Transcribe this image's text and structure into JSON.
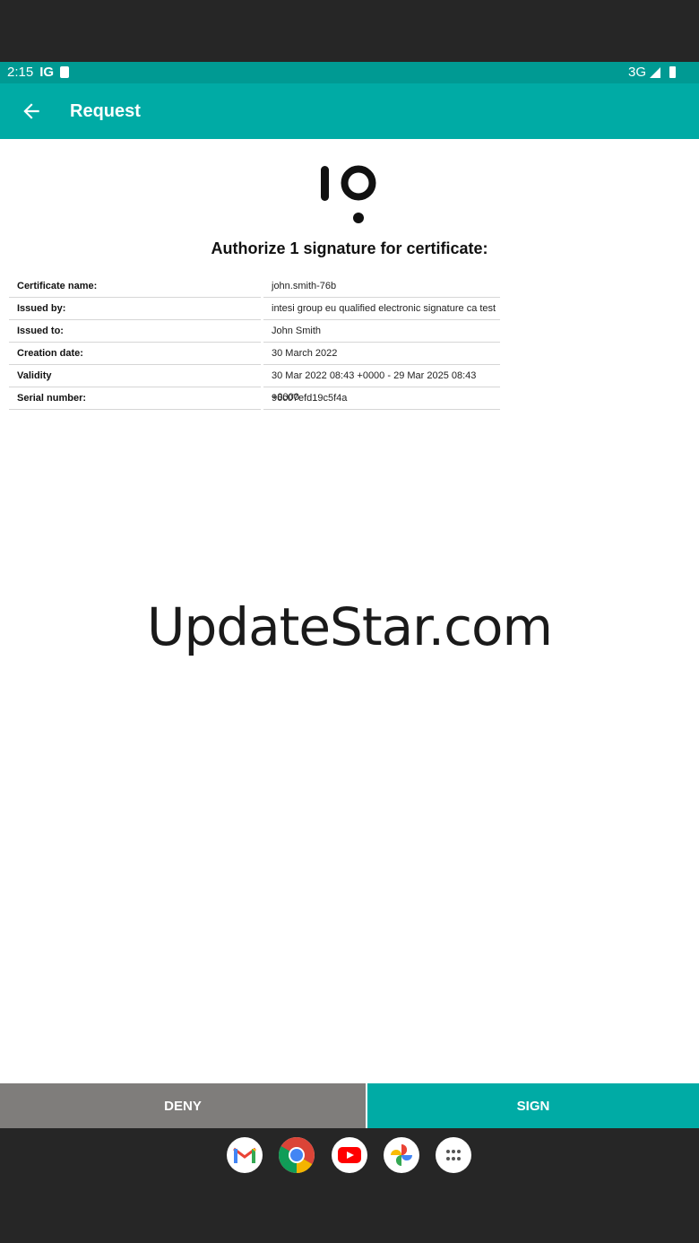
{
  "status_bar": {
    "time": "2:15",
    "ig": "IG",
    "network": "3G"
  },
  "app_bar": {
    "title": "Request"
  },
  "main": {
    "heading": "Authorize 1 signature for certificate:"
  },
  "certificate": [
    {
      "label": "Certificate name:",
      "value": "john.smith-76b"
    },
    {
      "label": "Issued by:",
      "value": "intesi group eu qualified electronic signature ca test"
    },
    {
      "label": "Issued to:",
      "value": "John Smith"
    },
    {
      "label": "Creation date:",
      "value": "30 March 2022"
    },
    {
      "label": "Validity",
      "value": "30 Mar 2022 08:43 +0000 - 29 Mar 2025 08:43 +0000"
    },
    {
      "label": "Serial number:",
      "value": "96c07efd19c5f4a"
    }
  ],
  "watermark": "UpdateStar.com",
  "actions": {
    "deny_label": "DENY",
    "sign_label": "SIGN"
  },
  "colors": {
    "accent": "#00aba5",
    "status_bar": "#009a93",
    "deny": "#7f7d7b"
  },
  "dock": [
    "gmail-icon",
    "chrome-icon",
    "youtube-icon",
    "photos-icon",
    "app-drawer-icon"
  ]
}
